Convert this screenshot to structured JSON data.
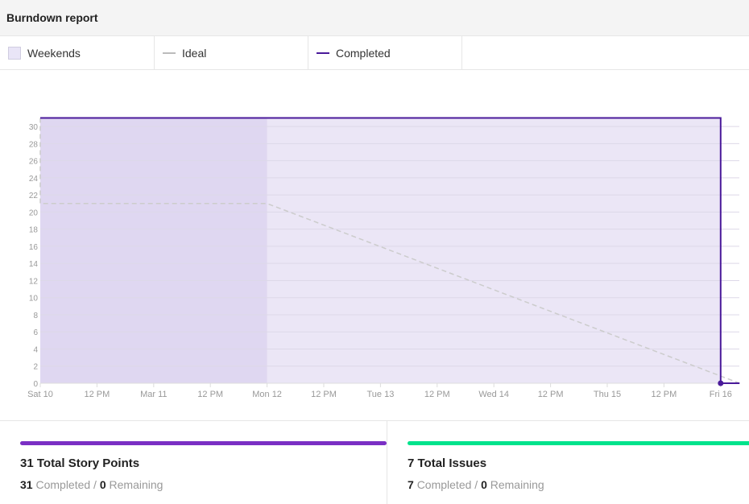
{
  "header": {
    "title": "Burndown report"
  },
  "legend": [
    {
      "label": "Weekends",
      "color": "#e9e5f7"
    },
    {
      "label": "Ideal",
      "color": "#bbbbbb"
    },
    {
      "label": "Completed",
      "color": "#4a1a9a"
    }
  ],
  "chart_data": {
    "type": "line",
    "title": "",
    "xlabel": "",
    "ylabel": "",
    "ylim": [
      0,
      31
    ],
    "yticks": [
      0,
      2,
      4,
      6,
      8,
      10,
      12,
      14,
      16,
      18,
      20,
      22,
      24,
      26,
      28,
      30
    ],
    "xticks": [
      "Sat 10",
      "12 PM",
      "Mar 11",
      "12 PM",
      "Mon 12",
      "12 PM",
      "Tue 13",
      "12 PM",
      "Wed 14",
      "12 PM",
      "Thu 15",
      "12 PM",
      "Fri 16"
    ],
    "grid": true,
    "weekend_range": [
      "Mar 10 00:00",
      "Mar 12 00:00"
    ],
    "series": [
      {
        "name": "Ideal",
        "style": "dashed",
        "color": "#cccccc",
        "points": [
          {
            "x": "Mar 10 00:00",
            "y": 31
          },
          {
            "x": "Mar 10 00:00",
            "y": 21
          },
          {
            "x": "Mar 12 00:00",
            "y": 21
          },
          {
            "x": "Mar 16 04:00",
            "y": 0
          }
        ]
      },
      {
        "name": "Completed",
        "style": "step",
        "color": "#4a1a9a",
        "points": [
          {
            "x": "Mar 10 00:00",
            "y": 31
          },
          {
            "x": "Mar 16 00:00",
            "y": 31
          },
          {
            "x": "Mar 16 00:00",
            "y": 0
          },
          {
            "x": "Mar 16 04:00",
            "y": 0
          }
        ]
      }
    ]
  },
  "stats": [
    {
      "title": "31 Total Story Points",
      "completed": "31",
      "completed_label": "Completed",
      "remaining": "0",
      "remaining_label": "Remaining",
      "color": "#7a2fc4"
    },
    {
      "title": "7 Total Issues",
      "completed": "7",
      "completed_label": "Completed",
      "remaining": "0",
      "remaining_label": "Remaining",
      "color": "#00e38c"
    }
  ]
}
